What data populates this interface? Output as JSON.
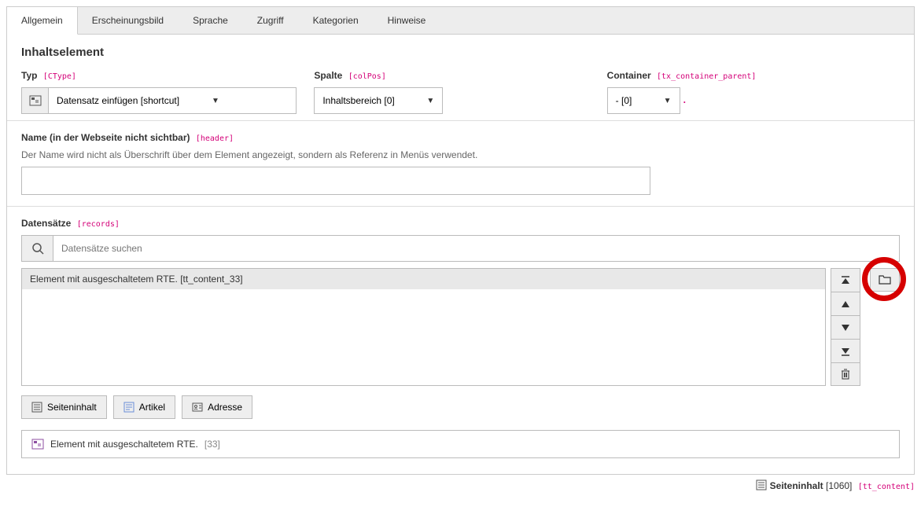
{
  "tabs": [
    "Allgemein",
    "Erscheinungsbild",
    "Sprache",
    "Zugriff",
    "Kategorien",
    "Hinweise"
  ],
  "activeTab": 0,
  "heading": "Inhaltselement",
  "typ": {
    "label": "Typ",
    "tech": "[CType]",
    "value": "Datensatz einfügen [shortcut]"
  },
  "spalte": {
    "label": "Spalte",
    "tech": "[colPos]",
    "value": "Inhaltsbereich [0]"
  },
  "container": {
    "label": "Container",
    "tech": "[tx_container_parent]",
    "value": "- [0]"
  },
  "name": {
    "label": "Name (in der Webseite nicht sichtbar)",
    "tech": "[header]",
    "hint": "Der Name wird nicht als Überschrift über dem Element angezeigt, sondern als Referenz in Menüs verwendet.",
    "value": ""
  },
  "records": {
    "label": "Datensätze",
    "tech": "[records]",
    "search_placeholder": "Datensätze suchen",
    "items": [
      "Element mit ausgeschaltetem RTE. [tt_content_33]"
    ]
  },
  "buttons": {
    "seiteninhalt": "Seiteninhalt",
    "artikel": "Artikel",
    "adresse": "Adresse"
  },
  "referenced": {
    "text": "Element mit ausgeschaltetem RTE.",
    "id": "[33]"
  },
  "footer": {
    "label": "Seiteninhalt",
    "id": "[1060]",
    "tech": "[tt_content]"
  }
}
